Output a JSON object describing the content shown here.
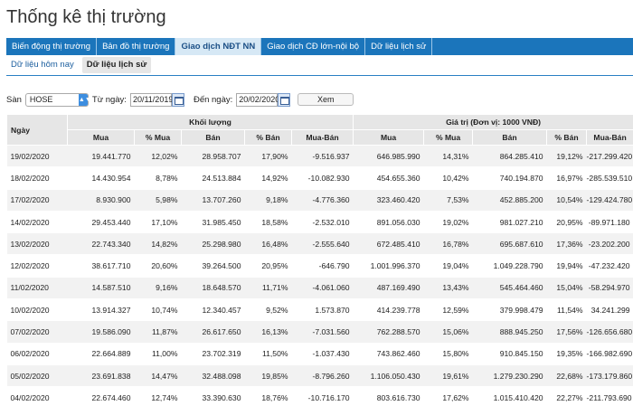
{
  "page_title": "Thống kê thị trường",
  "main_tabs": [
    {
      "label": "Biến động thị trường",
      "active": false
    },
    {
      "label": "Bản đồ thị trường",
      "active": false
    },
    {
      "label": "Giao dịch NĐT NN",
      "active": true
    },
    {
      "label": "Giao dịch CĐ lớn-nội bộ",
      "active": false
    },
    {
      "label": "Dữ liệu lịch sử",
      "active": false
    }
  ],
  "sub_tabs": [
    {
      "label": "Dữ liệu hôm nay",
      "active": false
    },
    {
      "label": "Dữ liệu lịch sử",
      "active": true
    }
  ],
  "filter": {
    "exchange_label": "Sàn",
    "exchange_value": "HOSE",
    "from_label": "Từ ngày:",
    "from_value": "20/11/2019",
    "to_label": "Đến ngày:",
    "to_value": "20/02/2020",
    "view_button": "Xem"
  },
  "table": {
    "date_header": "Ngày",
    "volume_group": "Khối lượng",
    "value_group": "Giá trị (Đơn vị: 1000 VNĐ)",
    "sub_headers": [
      "Mua",
      "% Mua",
      "Bán",
      "% Bán",
      "Mua-Bán",
      "Mua",
      "% Mua",
      "Bán",
      "% Bán",
      "Mua-Bán"
    ],
    "rows": [
      [
        "19/02/2020",
        "19.441.770",
        "12,02%",
        "28.958.707",
        "17,90%",
        "-9.516.937",
        "646.985.990",
        "14,31%",
        "864.285.410",
        "19,12%",
        "-217.299.420"
      ],
      [
        "18/02/2020",
        "14.430.954",
        "8,78%",
        "24.513.884",
        "14,92%",
        "-10.082.930",
        "454.655.360",
        "10,42%",
        "740.194.870",
        "16,97%",
        "-285.539.510"
      ],
      [
        "17/02/2020",
        "8.930.900",
        "5,98%",
        "13.707.260",
        "9,18%",
        "-4.776.360",
        "323.460.420",
        "7,53%",
        "452.885.200",
        "10,54%",
        "-129.424.780"
      ],
      [
        "14/02/2020",
        "29.453.440",
        "17,10%",
        "31.985.450",
        "18,58%",
        "-2.532.010",
        "891.056.030",
        "19,02%",
        "981.027.210",
        "20,95%",
        "-89.971.180"
      ],
      [
        "13/02/2020",
        "22.743.340",
        "14,82%",
        "25.298.980",
        "16,48%",
        "-2.555.640",
        "672.485.410",
        "16,78%",
        "695.687.610",
        "17,36%",
        "-23.202.200"
      ],
      [
        "12/02/2020",
        "38.617.710",
        "20,60%",
        "39.264.500",
        "20,95%",
        "-646.790",
        "1.001.996.370",
        "19,04%",
        "1.049.228.790",
        "19,94%",
        "-47.232.420"
      ],
      [
        "11/02/2020",
        "14.587.510",
        "9,16%",
        "18.648.570",
        "11,71%",
        "-4.061.060",
        "487.169.490",
        "13,43%",
        "545.464.460",
        "15,04%",
        "-58.294.970"
      ],
      [
        "10/02/2020",
        "13.914.327",
        "10,74%",
        "12.340.457",
        "9,52%",
        "1.573.870",
        "414.239.778",
        "12,59%",
        "379.998.479",
        "11,54%",
        "34.241.299"
      ],
      [
        "07/02/2020",
        "19.586.090",
        "11,87%",
        "26.617.650",
        "16,13%",
        "-7.031.560",
        "762.288.570",
        "15,06%",
        "888.945.250",
        "17,56%",
        "-126.656.680"
      ],
      [
        "06/02/2020",
        "22.664.889",
        "11,00%",
        "23.702.319",
        "11,50%",
        "-1.037.430",
        "743.862.460",
        "15,80%",
        "910.845.150",
        "19,35%",
        "-166.982.690"
      ],
      [
        "05/02/2020",
        "23.691.838",
        "14,47%",
        "32.488.098",
        "19,85%",
        "-8.796.260",
        "1.106.050.430",
        "19,61%",
        "1.279.230.290",
        "22,68%",
        "-173.179.860"
      ],
      [
        "04/02/2020",
        "22.674.460",
        "12,74%",
        "33.390.630",
        "18,76%",
        "-10.716.170",
        "803.616.730",
        "17,62%",
        "1.015.410.420",
        "22,27%",
        "-211.793.690"
      ]
    ]
  }
}
